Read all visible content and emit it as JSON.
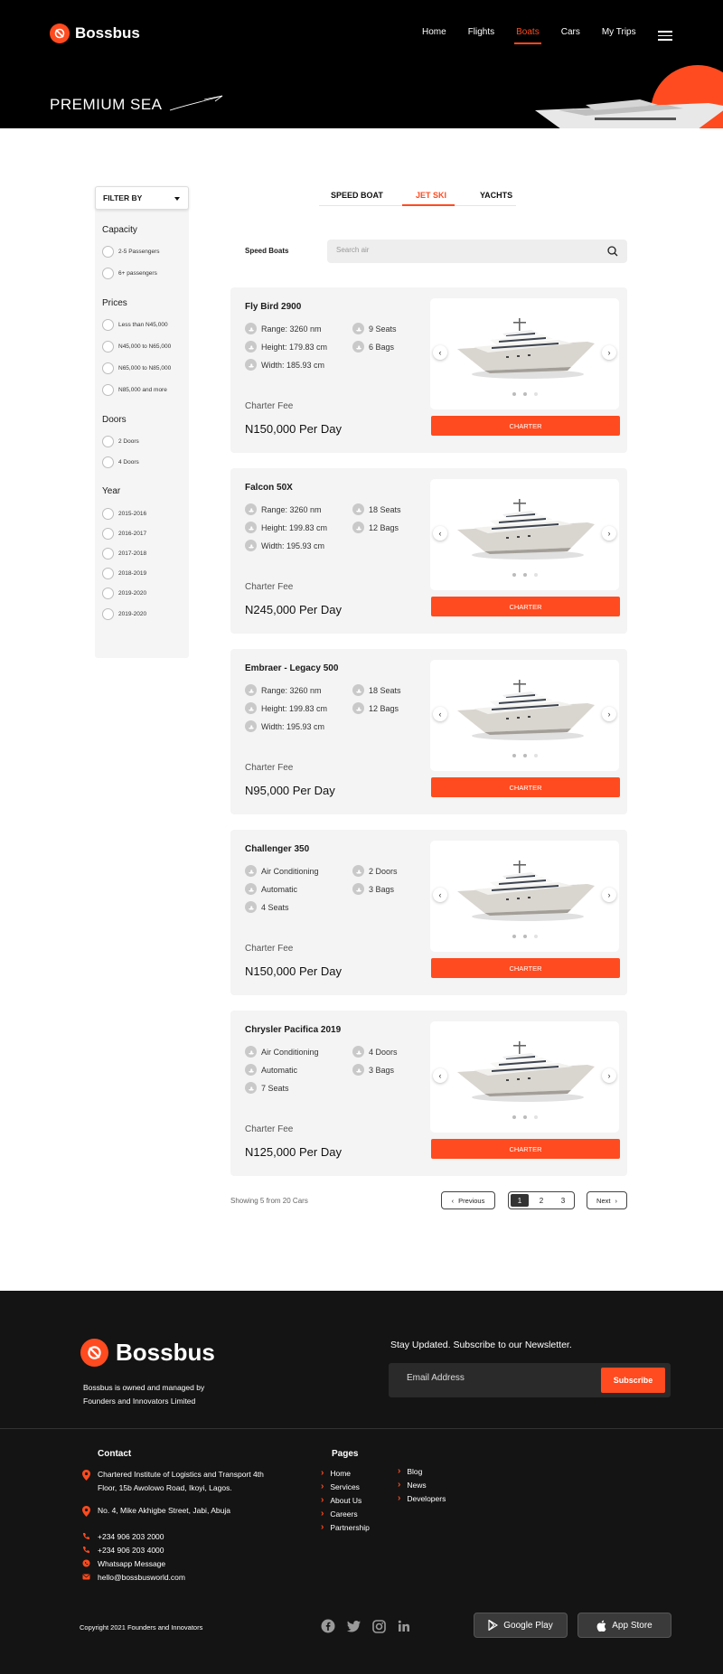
{
  "brand": {
    "name": "Bossbus",
    "accent": "#ff4b1f"
  },
  "nav": {
    "items": [
      "Home",
      "Flights",
      "Boats",
      "Cars",
      "My Trips"
    ],
    "active_index": 2
  },
  "hero": {
    "title": "PREMIUM SEA"
  },
  "filter": {
    "select_label": "FILTER BY",
    "groups": [
      {
        "title": "Capacity",
        "options": [
          "2-5 Passengers",
          "6+ passengers"
        ]
      },
      {
        "title": "Prices",
        "options": [
          "Less than N45,000",
          "N45,000 to N65,000",
          "N65,000 to N85,000",
          "N85,000 and more"
        ]
      },
      {
        "title": "Doors",
        "options": [
          "2 Doors",
          "4 Doors"
        ]
      },
      {
        "title": "Year",
        "options": [
          "2015-2016",
          "2016-2017",
          "2017-2018",
          "2018-2019",
          "2019-2020",
          "2019-2020"
        ]
      }
    ]
  },
  "tabs": {
    "items": [
      "SPEED BOAT",
      "JET SKI",
      "YACHTS"
    ],
    "active_index": 1
  },
  "search": {
    "label": "Speed Boats",
    "placeholder": "Search air"
  },
  "listings": [
    {
      "title": "Fly Bird 2900",
      "features_left": [
        "Range: 3260 nm",
        "Height: 179.83 cm",
        "Width: 185.93 cm"
      ],
      "features_right": [
        "9 Seats",
        "6 Bags"
      ],
      "fee_label": "Charter Fee",
      "price": "N150,000 Per Day",
      "button": "CHARTER"
    },
    {
      "title": "Falcon 50X",
      "features_left": [
        "Range: 3260 nm",
        "Height: 199.83 cm",
        "Width: 195.93 cm"
      ],
      "features_right": [
        "18 Seats",
        "12 Bags"
      ],
      "fee_label": "Charter Fee",
      "price": "N245,000 Per Day",
      "button": "CHARTER"
    },
    {
      "title": "Embraer - Legacy 500",
      "features_left": [
        "Range: 3260 nm",
        "Height: 199.83 cm",
        "Width: 195.93 cm"
      ],
      "features_right": [
        "18 Seats",
        "12 Bags"
      ],
      "fee_label": "Charter Fee",
      "price": "N95,000 Per Day",
      "button": "CHARTER"
    },
    {
      "title": "Challenger 350",
      "features_left": [
        "Air Conditioning",
        "Automatic",
        "4 Seats"
      ],
      "features_right": [
        "2 Doors",
        "3 Bags"
      ],
      "fee_label": "Charter Fee",
      "price": "N150,000 Per Day",
      "button": "CHARTER"
    },
    {
      "title": "Chrysler Pacifica 2019",
      "features_left": [
        "Air Conditioning",
        "Automatic",
        "7 Seats"
      ],
      "features_right": [
        "4 Doors",
        "3 Bags"
      ],
      "fee_label": "Charter Fee",
      "price": "N125,000 Per Day",
      "button": "CHARTER"
    }
  ],
  "pagination": {
    "summary": "Showing 5 from 20 Cars",
    "previous": "Previous",
    "next": "Next",
    "pages": [
      "1",
      "2",
      "3"
    ],
    "current": "1"
  },
  "footer": {
    "brand": "Bossbus",
    "about": "Bossbus is owned and managed by Founders and Innovators Limited",
    "newsletter_title": "Stay Updated. Subscribe to our Newsletter.",
    "email_placeholder": "Email Address",
    "subscribe": "Subscribe",
    "contact_title": "Contact",
    "address1": "Chartered Institute of Logistics and Transport 4th Floor, 15b Awolowo Road, Ikoyi, Lagos.",
    "address2": "No. 4, Mike Akhigbe Street, Jabi, Abuja",
    "phone1": "+234 906 203 2000",
    "phone2": "+234 906 203 4000",
    "whatsapp": "Whatsapp Message",
    "email": "hello@bossbusworld.com",
    "pages_title": "Pages",
    "pages_col1": [
      "Home",
      "Services",
      "About Us",
      "Careers",
      "Partnership"
    ],
    "pages_col2": [
      "Blog",
      "News",
      "Developers"
    ],
    "copyright": "Copyright 2021 Founders and Innovators",
    "social_icons": [
      "facebook-icon",
      "twitter-icon",
      "instagram-icon",
      "linkedin-icon"
    ],
    "stores": [
      "Google Play",
      "App Store"
    ]
  }
}
